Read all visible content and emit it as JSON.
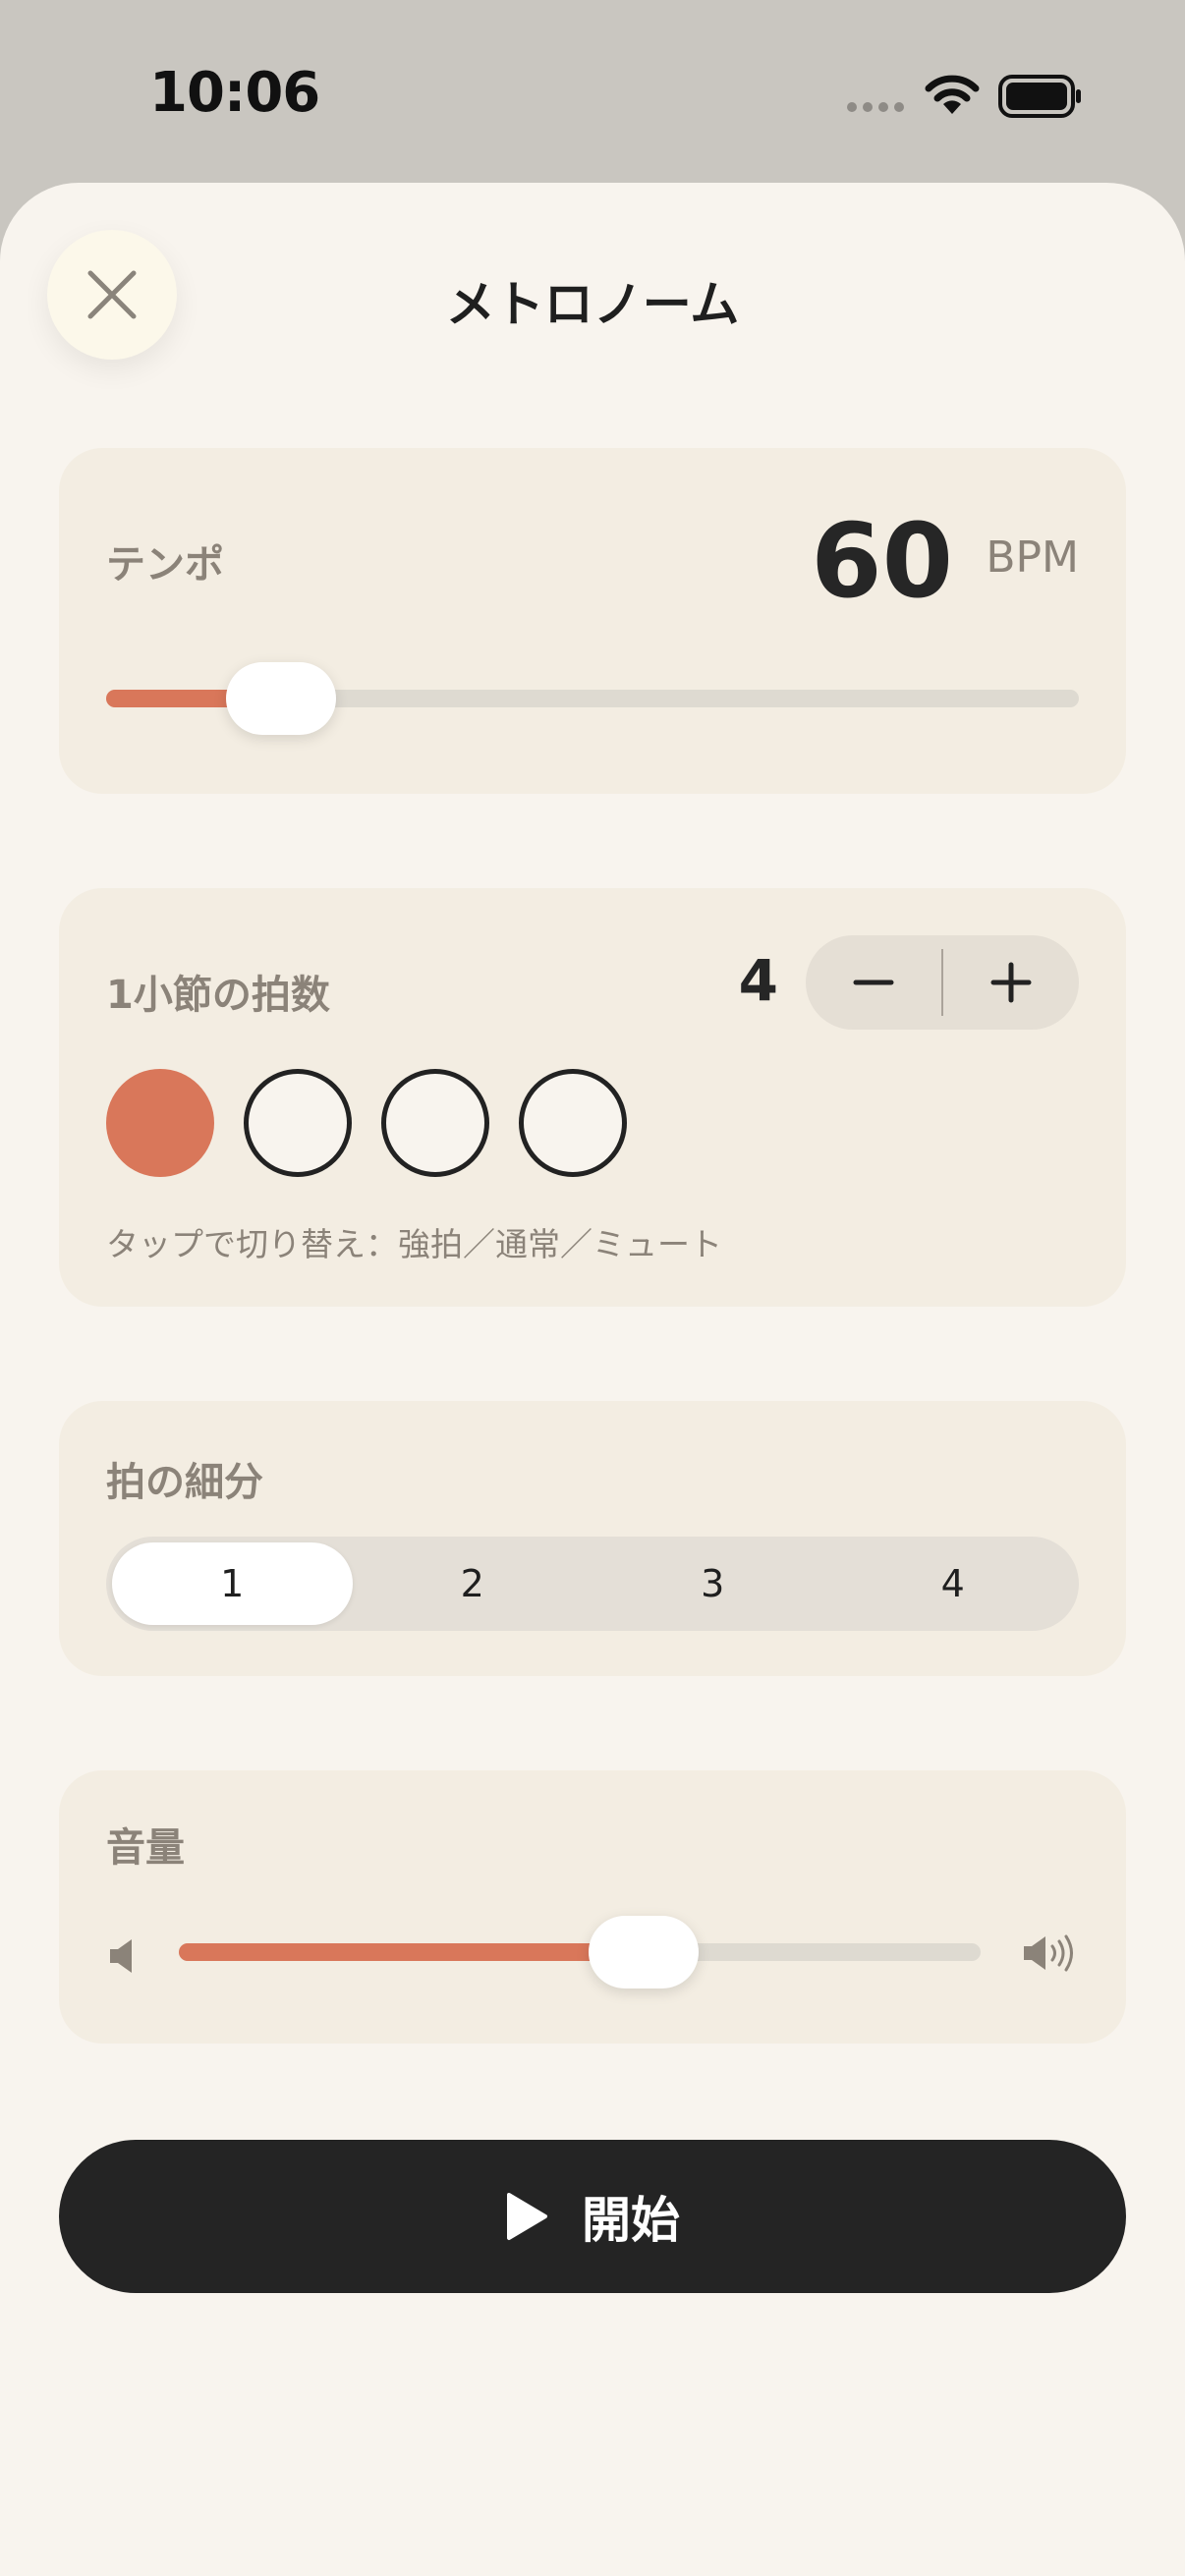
{
  "status_bar": {
    "time": "10:06"
  },
  "header": {
    "title": "メトロノーム"
  },
  "tempo": {
    "label": "テンポ",
    "value": "60",
    "unit": "BPM",
    "slider_fraction": 0.18
  },
  "beats": {
    "label": "1小節の拍数",
    "count": "4",
    "decrement_label": "−",
    "increment_label": "+",
    "states": [
      "accent",
      "normal",
      "normal",
      "normal"
    ],
    "hint": "タップで切り替え：強拍／通常／ミュート"
  },
  "subdivision": {
    "label": "拍の細分",
    "options": [
      "1",
      "2",
      "3",
      "4"
    ],
    "selected_index": 0
  },
  "volume": {
    "label": "音量",
    "slider_fraction": 0.58
  },
  "start": {
    "label": "開始"
  },
  "colors": {
    "accent": "#d9775a",
    "background": "#f8f4ee",
    "card": "#f3ede2",
    "dark": "#242424"
  }
}
